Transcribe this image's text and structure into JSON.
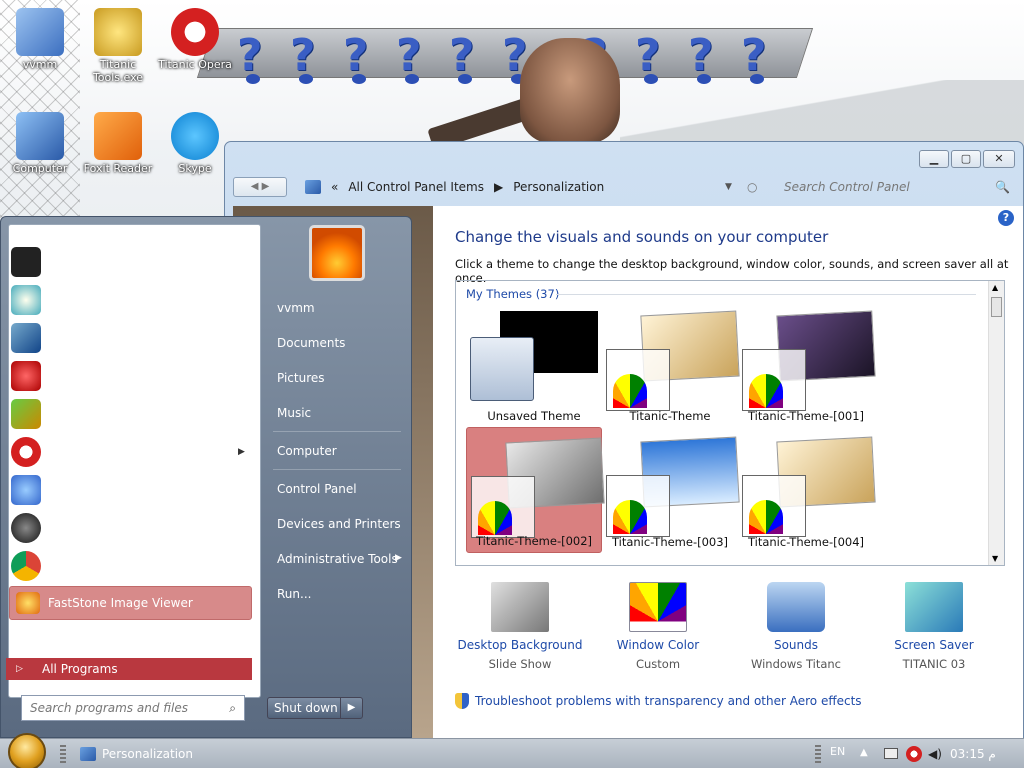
{
  "desktop": {
    "icons": [
      {
        "label": "vvmm",
        "color": "#5c8fd6"
      },
      {
        "label": "Titanic Tools.exe",
        "color": "#e8d25a"
      },
      {
        "label": "Titanic Opera",
        "color": "#cc1f1f"
      },
      {
        "label": "Computer",
        "color": "#6aa0e0"
      },
      {
        "label": "Foxit Reader",
        "color": "#f07a1a"
      },
      {
        "label": "Skype",
        "color": "#1c9ae2"
      }
    ]
  },
  "window": {
    "breadcrumb_back": "«",
    "breadcrumb": [
      "All Control Panel Items",
      "Personalization"
    ],
    "search_placeholder": "Search Control Panel",
    "heading": "Change the visuals and sounds on your computer",
    "subtext": "Click a theme to change the desktop background, window color, sounds, and screen saver all at once.",
    "group_label": "My Themes (37)",
    "themes": [
      {
        "label": "Unsaved Theme"
      },
      {
        "label": "Titanic-Theme"
      },
      {
        "label": "Titanic-Theme-[001]"
      },
      {
        "label": "Titanic-Theme-[002]",
        "selected": true
      },
      {
        "label": "Titanic-Theme-[003]"
      },
      {
        "label": "Titanic-Theme-[004]"
      }
    ],
    "options": [
      {
        "title": "Desktop Background",
        "value": "Slide Show"
      },
      {
        "title": "Window Color",
        "value": "Custom"
      },
      {
        "title": "Sounds",
        "value": "Windows Titanc"
      },
      {
        "title": "Screen Saver",
        "value": "TITANIC 03"
      }
    ],
    "troubleshoot": "Troubleshoot problems with transparency and other Aero effects"
  },
  "start_menu": {
    "pinned_selected": "FastStone Image Viewer",
    "all_programs": "All Programs",
    "search_placeholder": "Search programs and files",
    "right_items": [
      "vvmm",
      "Documents",
      "Pictures",
      "Music",
      "Computer",
      "Control Panel",
      "Devices and Printers",
      "Administrative Tools",
      "Run..."
    ],
    "shutdown": "Shut down"
  },
  "taskbar": {
    "task_label": "Personalization",
    "lang": "EN",
    "time": "03:15 م"
  },
  "colors": {
    "accent": "#1e4aa8",
    "selected_tile": "#d98080",
    "all_programs_bar": "#b9383f"
  }
}
